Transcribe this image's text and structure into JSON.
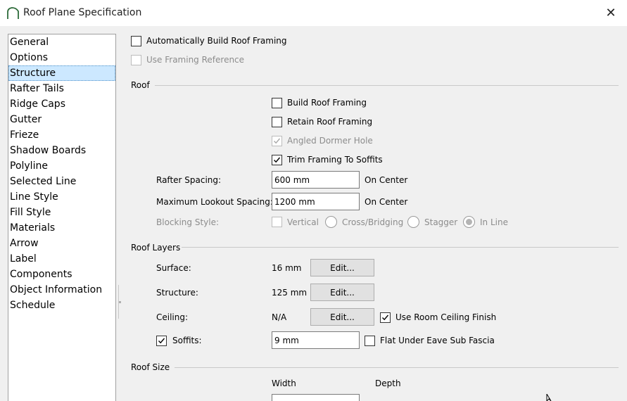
{
  "window": {
    "title": "Roof Plane Specification"
  },
  "nav": {
    "items": [
      "General",
      "Options",
      "Structure",
      "Rafter Tails",
      "Ridge Caps",
      "Gutter",
      "Frieze",
      "Shadow Boards",
      "Polyline",
      "Selected Line",
      "Line Style",
      "Fill Style",
      "Materials",
      "Arrow",
      "Label",
      "Components",
      "Object Information",
      "Schedule"
    ],
    "selected": "Structure"
  },
  "top": {
    "auto_build_framing": "Automatically Build Roof Framing",
    "use_framing_reference": "Use Framing Reference"
  },
  "roof": {
    "heading": "Roof",
    "build_roof_framing": "Build Roof Framing",
    "retain_roof_framing": "Retain Roof Framing",
    "angled_dormer_hole": "Angled Dormer Hole",
    "trim_framing_to_soffits": "Trim Framing To Soffits",
    "rafter_spacing_label": "Rafter Spacing:",
    "rafter_spacing_value": "600 mm",
    "on_center_1": "On Center",
    "max_lookout_label": "Maximum Lookout Spacing:",
    "max_lookout_value": "1200 mm",
    "on_center_2": "On Center",
    "blocking_style_label": "Blocking Style:",
    "blocking_vertical": "Vertical",
    "blocking_cross": "Cross/Bridging",
    "blocking_stagger": "Stagger",
    "blocking_inline": "In Line",
    "blocking_selected": "In Line"
  },
  "layers": {
    "heading": "Roof Layers",
    "surface_label": "Surface:",
    "surface_value": "16 mm",
    "structure_label": "Structure:",
    "structure_value": "125 mm",
    "ceiling_label": "Ceiling:",
    "ceiling_value": "N/A",
    "edit_label": "Edit...",
    "use_room_ceiling_finish": "Use Room Ceiling Finish",
    "soffits_label": "Soffits:",
    "soffits_value": "9 mm",
    "flat_under_eave": "Flat Under Eave Sub Fascia"
  },
  "size": {
    "heading": "Roof Size",
    "width_header": "Width",
    "depth_header": "Depth"
  },
  "checkbox_states": {
    "auto_build_framing": false,
    "use_framing_reference": false,
    "build_roof_framing": false,
    "retain_roof_framing": false,
    "angled_dormer_hole": true,
    "trim_framing_to_soffits": true,
    "blocking_vertical": false,
    "use_room_ceiling_finish": true,
    "soffits": true,
    "flat_under_eave": false
  }
}
